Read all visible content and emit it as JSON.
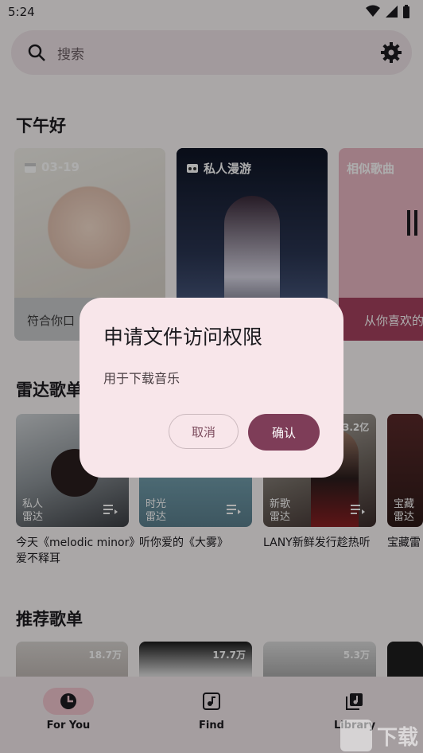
{
  "status_bar": {
    "time": "5:24"
  },
  "search": {
    "placeholder": "搜索"
  },
  "greeting": "下午好",
  "daily_cards": [
    {
      "label": "03-19",
      "footer": "符合你口"
    },
    {
      "label": "私人漫游",
      "footer": ""
    },
    {
      "label": "相似歌曲",
      "footer": "从你喜欢的"
    }
  ],
  "radar": {
    "title": "雷达歌单",
    "cards": [
      {
        "tag_line1": "私人",
        "tag_line2": "雷达",
        "caption": "今天《melodic minor》爱不释耳",
        "count": ""
      },
      {
        "tag_line1": "时光",
        "tag_line2": "雷达",
        "caption": "听你爱的《大雾》",
        "count": ""
      },
      {
        "tag_line1": "新歌",
        "tag_line2": "雷达",
        "caption": "LANY新鲜发行趁热听",
        "count": "3.2亿"
      },
      {
        "tag_line1": "宝藏",
        "tag_line2": "雷达",
        "caption": "宝藏雷",
        "count": ""
      }
    ]
  },
  "recommended": {
    "title": "推荐歌单",
    "counts": [
      "18.7万",
      "17.7万",
      "5.3万",
      ""
    ]
  },
  "nav": [
    {
      "label": "For You"
    },
    {
      "label": "Find"
    },
    {
      "label": "Library"
    }
  ],
  "dialog": {
    "title": "申请文件访问权限",
    "body": "用于下载音乐",
    "cancel": "取消",
    "confirm": "确认"
  },
  "watermark": {
    "text": "下载"
  },
  "colors": {
    "accent": "#7e3d58",
    "dialog_bg": "#f8e6ea",
    "nav_pill": "#f2c6cf"
  }
}
